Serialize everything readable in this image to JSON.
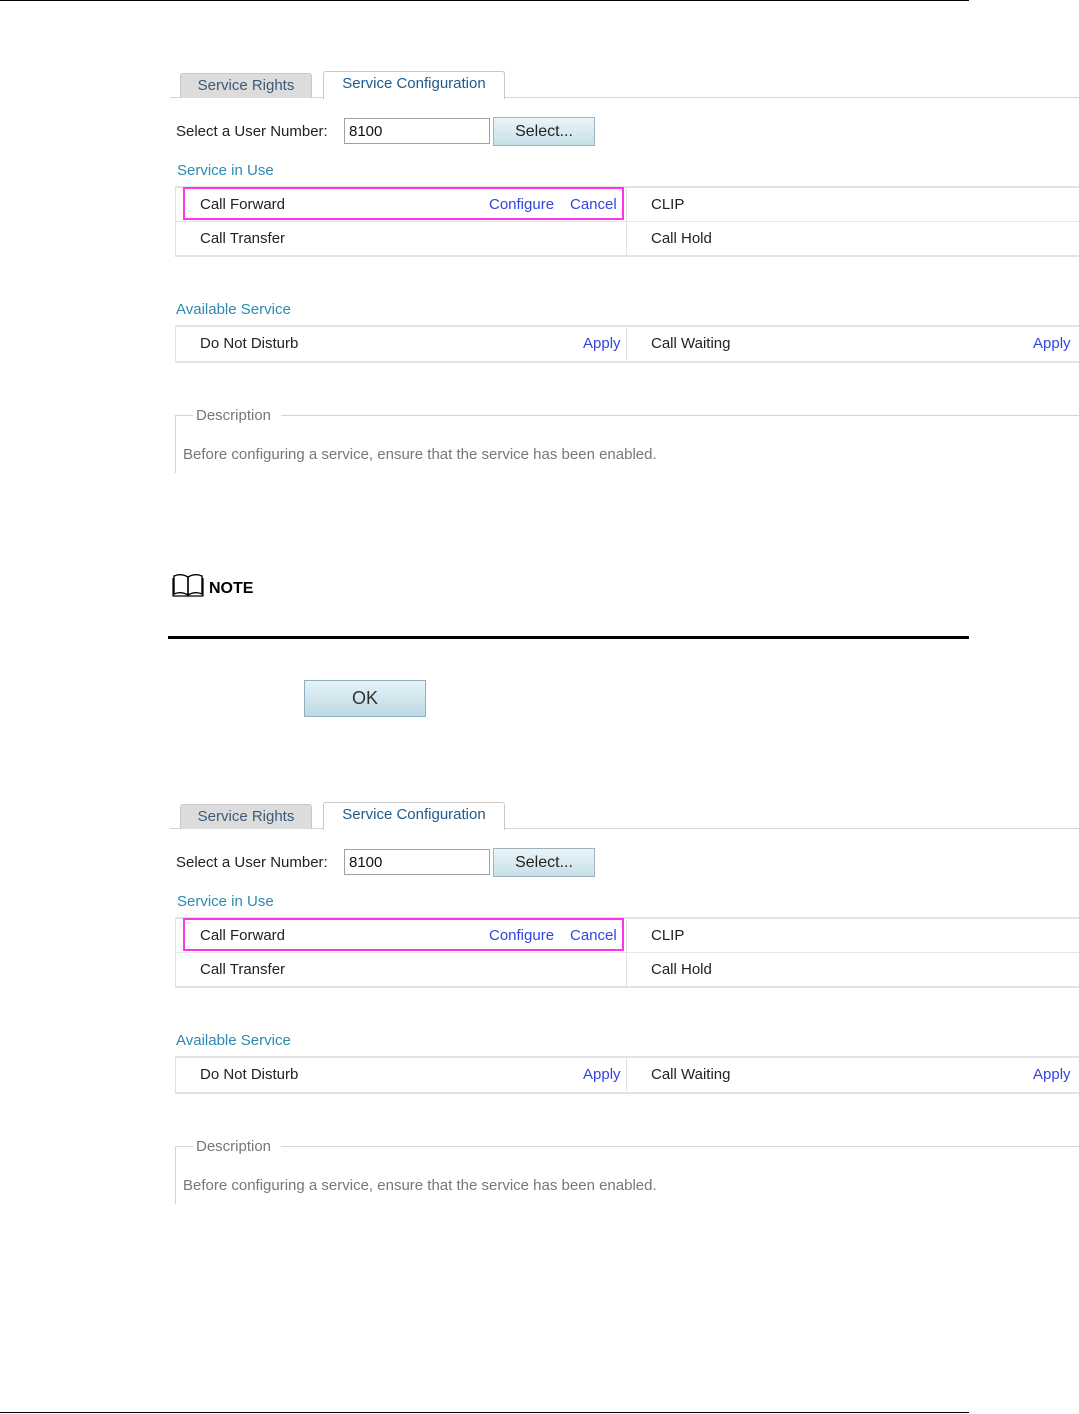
{
  "panels": [
    {
      "tabs": {
        "inactive": "Service Rights",
        "active": "Service Configuration"
      },
      "user": {
        "label": "Select a User Number:",
        "value": "8100",
        "button": "Select..."
      },
      "service_in_use": {
        "title": "Service in Use",
        "row1": {
          "left": "Call Forward",
          "configure": "Configure",
          "cancel": "Cancel",
          "right": "CLIP"
        },
        "row2": {
          "left": "Call Transfer",
          "right": "Call Hold"
        }
      },
      "available": {
        "title": "Available Service",
        "row1": {
          "left": "Do Not Disturb",
          "left_action": "Apply",
          "right": "Call Waiting",
          "right_action": "Apply"
        }
      },
      "description": {
        "legend": "Description",
        "text": "Before configuring a service, ensure that the service has been enabled."
      }
    },
    {
      "tabs": {
        "inactive": "Service Rights",
        "active": "Service Configuration"
      },
      "user": {
        "label": "Select a User Number:",
        "value": "8100",
        "button": "Select..."
      },
      "service_in_use": {
        "title": "Service in Use",
        "row1": {
          "left": "Call Forward",
          "configure": "Configure",
          "cancel": "Cancel",
          "right": "CLIP"
        },
        "row2": {
          "left": "Call Transfer",
          "right": "Call Hold"
        }
      },
      "available": {
        "title": "Available Service",
        "row1": {
          "left": "Do Not Disturb",
          "left_action": "Apply",
          "right": "Call Waiting",
          "right_action": "Apply"
        }
      },
      "description": {
        "legend": "Description",
        "text": "Before configuring a service, ensure that the service has been enabled."
      }
    }
  ],
  "note": {
    "label": "NOTE",
    "icon": "open-book-icon"
  },
  "ok_button": "OK",
  "colors": {
    "section_title": "#2b8ab0",
    "link": "#3344dd",
    "highlight": "#ff33ee"
  }
}
